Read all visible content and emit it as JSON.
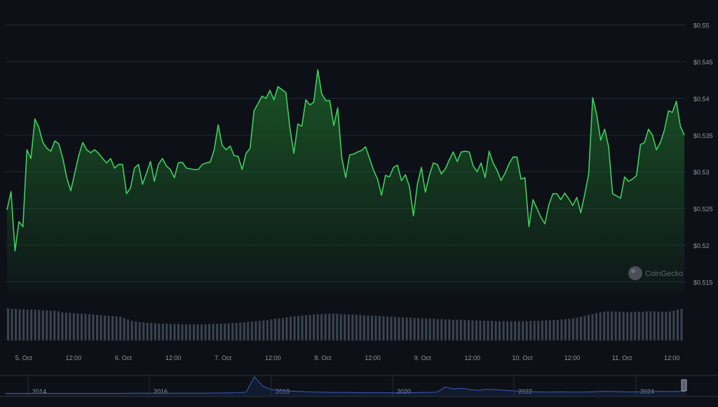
{
  "colors": {
    "background": "#0d1117",
    "grid": "#1f2a35",
    "line": "#3fce5e",
    "fill_top": "#1e6a2a",
    "volume_bar": "#3a4350",
    "axis_text": "#8c96a3",
    "nav_line": "#3a5bbd"
  },
  "watermark": {
    "text": "CoinGecko",
    "icon": "coingecko-logo-icon"
  },
  "chart_data": {
    "type": "line",
    "title": "",
    "xlabel": "",
    "ylabel": "",
    "y_ticks": [
      "$0.515",
      "$0.52",
      "$0.525",
      "$0.53",
      "$0.535",
      "$0.54",
      "$0.545",
      "$0.55"
    ],
    "y_tick_values": [
      0.515,
      0.52,
      0.525,
      0.53,
      0.535,
      0.54,
      0.545,
      0.55
    ],
    "ylim": [
      0.5135,
      0.5515
    ],
    "xlim": [
      "4 Oct 20:00",
      "11 Oct 15:00"
    ],
    "x_ticks": [
      {
        "label": "5. Oct",
        "time": "5 Oct 00:00"
      },
      {
        "label": "12:00",
        "time": "5 Oct 12:00"
      },
      {
        "label": "6. Oct",
        "time": "6 Oct 00:00"
      },
      {
        "label": "12:00",
        "time": "6 Oct 12:00"
      },
      {
        "label": "7. Oct",
        "time": "7 Oct 00:00"
      },
      {
        "label": "12:00",
        "time": "7 Oct 12:00"
      },
      {
        "label": "8. Oct",
        "time": "8 Oct 00:00"
      },
      {
        "label": "12:00",
        "time": "8 Oct 12:00"
      },
      {
        "label": "9. Oct",
        "time": "9 Oct 00:00"
      },
      {
        "label": "12:00",
        "time": "9 Oct 12:00"
      },
      {
        "label": "10. Oct",
        "time": "10 Oct 00:00"
      },
      {
        "label": "12:00",
        "time": "10 Oct 12:00"
      },
      {
        "label": "11. Oct",
        "time": "11 Oct 00:00"
      },
      {
        "label": "12:00",
        "time": "11 Oct 12:00"
      }
    ],
    "series": [
      {
        "values": [
          0.5248,
          0.5273,
          0.5192,
          0.5232,
          0.5225,
          0.533,
          0.5318,
          0.5372,
          0.536,
          0.534,
          0.5332,
          0.5328,
          0.5342,
          0.5338,
          0.5318,
          0.5292,
          0.5274,
          0.5298,
          0.5322,
          0.534,
          0.533,
          0.5326,
          0.533,
          0.5325,
          0.5318,
          0.5312,
          0.5318,
          0.5305,
          0.531,
          0.531,
          0.527,
          0.5278,
          0.5305,
          0.531,
          0.5283,
          0.5298,
          0.5314,
          0.5287,
          0.531,
          0.5318,
          0.5308,
          0.5303,
          0.5292,
          0.5312,
          0.5313,
          0.5305,
          0.5304,
          0.5303,
          0.5303,
          0.531,
          0.5312,
          0.5313,
          0.533,
          0.5364,
          0.5336,
          0.533,
          0.5335,
          0.5322,
          0.5321,
          0.5303,
          0.5325,
          0.5332,
          0.5383,
          0.5393,
          0.5403,
          0.54,
          0.5411,
          0.5398,
          0.5416,
          0.5412,
          0.5408,
          0.536,
          0.5325,
          0.5365,
          0.5362,
          0.5398,
          0.5391,
          0.5395,
          0.5439,
          0.5406,
          0.5397,
          0.5397,
          0.5363,
          0.5387,
          0.532,
          0.5292,
          0.5323,
          0.5324,
          0.5327,
          0.5329,
          0.5334,
          0.5318,
          0.5302,
          0.529,
          0.5268,
          0.5295,
          0.5293,
          0.5306,
          0.5309,
          0.5288,
          0.5296,
          0.528,
          0.524,
          0.5283,
          0.5306,
          0.5272,
          0.5295,
          0.5312,
          0.531,
          0.5297,
          0.5304,
          0.5316,
          0.5327,
          0.5314,
          0.5327,
          0.5328,
          0.5327,
          0.5308,
          0.53,
          0.5312,
          0.5292,
          0.5328,
          0.5312,
          0.5302,
          0.5288,
          0.5298,
          0.5311,
          0.532,
          0.532,
          0.529,
          0.5292,
          0.5225,
          0.5262,
          0.525,
          0.5238,
          0.5229,
          0.5255,
          0.527,
          0.527,
          0.5262,
          0.5271,
          0.5263,
          0.5254,
          0.5265,
          0.5244,
          0.5269,
          0.5297,
          0.5401,
          0.5378,
          0.5343,
          0.5358,
          0.5334,
          0.527,
          0.5267,
          0.5264,
          0.5293,
          0.5287,
          0.529,
          0.5295,
          0.5337,
          0.534,
          0.5358,
          0.535,
          0.533,
          0.534,
          0.5357,
          0.5383,
          0.5381,
          0.5396,
          0.5362,
          0.535
        ]
      }
    ],
    "volume": [
      0.92,
      0.9,
      0.9,
      0.89,
      0.89,
      0.88,
      0.88,
      0.88,
      0.87,
      0.86,
      0.86,
      0.85,
      0.85,
      0.83,
      0.8,
      0.79,
      0.79,
      0.78,
      0.77,
      0.76,
      0.76,
      0.75,
      0.74,
      0.73,
      0.72,
      0.71,
      0.7,
      0.7,
      0.69,
      0.68,
      0.64,
      0.6,
      0.56,
      0.54,
      0.52,
      0.52,
      0.5,
      0.5,
      0.49,
      0.48,
      0.48,
      0.48,
      0.47,
      0.47,
      0.47,
      0.46,
      0.46,
      0.46,
      0.46,
      0.46,
      0.46,
      0.46,
      0.47,
      0.47,
      0.47,
      0.48,
      0.48,
      0.49,
      0.5,
      0.5,
      0.51,
      0.52,
      0.53,
      0.54,
      0.55,
      0.56,
      0.57,
      0.58,
      0.6,
      0.62,
      0.63,
      0.64,
      0.66,
      0.68,
      0.69,
      0.7,
      0.71,
      0.72,
      0.73,
      0.74,
      0.75,
      0.75,
      0.76,
      0.76,
      0.76,
      0.76,
      0.75,
      0.75,
      0.74,
      0.74,
      0.73,
      0.73,
      0.72,
      0.71,
      0.71,
      0.7,
      0.7,
      0.69,
      0.68,
      0.68,
      0.67,
      0.66,
      0.66,
      0.65,
      0.65,
      0.64,
      0.64,
      0.63,
      0.63,
      0.62,
      0.62,
      0.61,
      0.61,
      0.6,
      0.6,
      0.59,
      0.59,
      0.59,
      0.58,
      0.58,
      0.57,
      0.57,
      0.57,
      0.56,
      0.56,
      0.56,
      0.55,
      0.55,
      0.55,
      0.55,
      0.55,
      0.55,
      0.55,
      0.55,
      0.55,
      0.56,
      0.56,
      0.56,
      0.57,
      0.57,
      0.58,
      0.58,
      0.59,
      0.6,
      0.61,
      0.62,
      0.63,
      0.65,
      0.68,
      0.7,
      0.73,
      0.75,
      0.78,
      0.8,
      0.82,
      0.83,
      0.83,
      0.82,
      0.82,
      0.81,
      0.81,
      0.81,
      0.82,
      0.82,
      0.82,
      0.83,
      0.83,
      0.83,
      0.82,
      0.82,
      0.82,
      0.83,
      0.85,
      0.88,
      0.9
    ],
    "navigator": {
      "labels": [
        "2014",
        "2016",
        "2018",
        "2020",
        "2022",
        "2024"
      ],
      "series": [
        0.02,
        0.02,
        0.02,
        0.02,
        0.02,
        0.02,
        0.02,
        0.02,
        0.02,
        0.02,
        0.02,
        0.02,
        0.02,
        0.02,
        0.02,
        0.03,
        0.03,
        0.03,
        0.03,
        0.03,
        0.03,
        0.03,
        0.03,
        0.03,
        0.03,
        0.04,
        0.04,
        0.05,
        0.06,
        0.09,
        1.0,
        0.45,
        0.25,
        0.2,
        0.16,
        0.14,
        0.12,
        0.1,
        0.09,
        0.08,
        0.08,
        0.07,
        0.07,
        0.06,
        0.06,
        0.06,
        0.06,
        0.05,
        0.05,
        0.06,
        0.07,
        0.08,
        0.09,
        0.4,
        0.28,
        0.32,
        0.25,
        0.2,
        0.26,
        0.24,
        0.21,
        0.18,
        0.14,
        0.12,
        0.11,
        0.1,
        0.1,
        0.11,
        0.1,
        0.1,
        0.1,
        0.12,
        0.14,
        0.13,
        0.12,
        0.11,
        0.11,
        0.12,
        0.13,
        0.14,
        0.13,
        0.14,
        0.15
      ]
    }
  }
}
